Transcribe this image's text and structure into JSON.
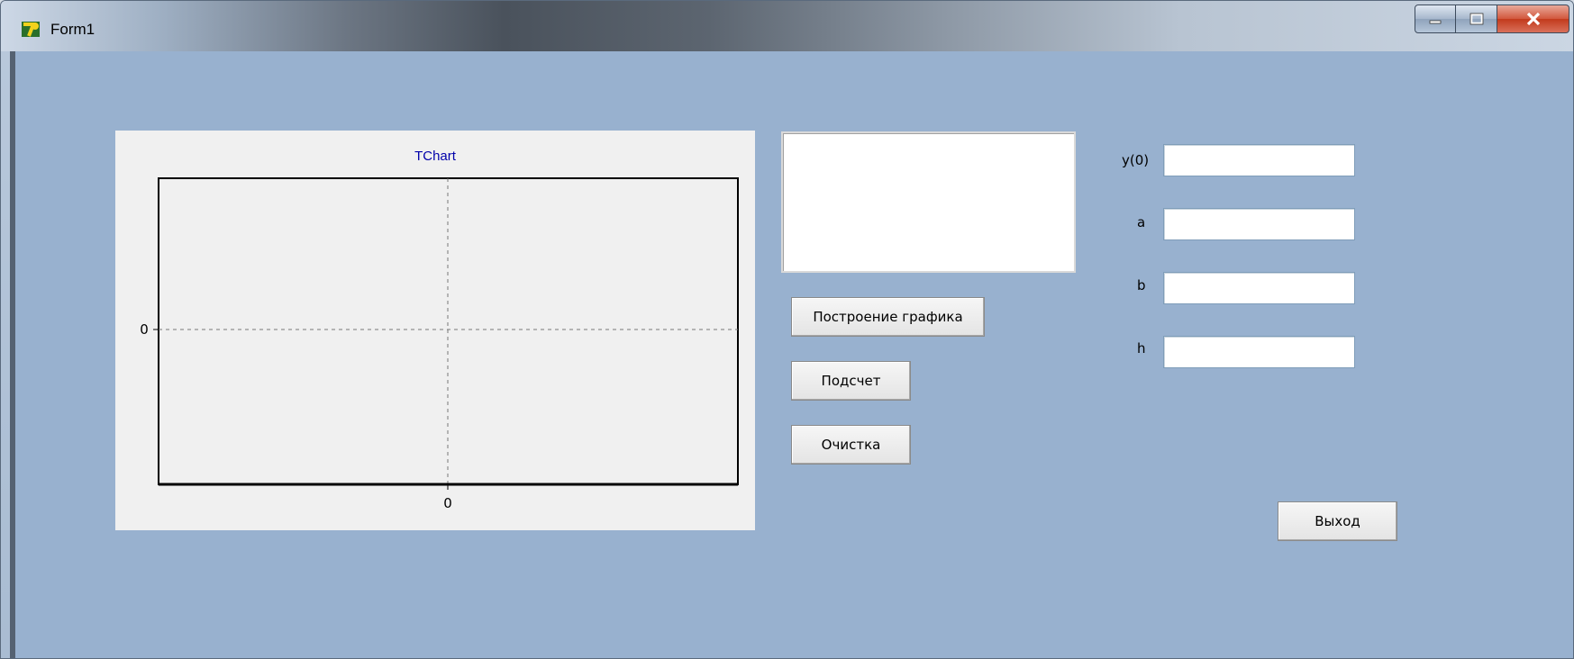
{
  "window": {
    "title": "Form1"
  },
  "chart": {
    "title": "TChart",
    "y_tick": "0",
    "x_tick": "0"
  },
  "chart_data": {
    "type": "line",
    "title": "TChart",
    "x": [],
    "y": [],
    "xticks": [
      "0"
    ],
    "yticks": [
      "0"
    ],
    "grid": true,
    "xlabel": "",
    "ylabel": ""
  },
  "buttons": {
    "plot": "Построение графика",
    "count": "Подсчет",
    "clear": "Очистка",
    "exit": "Выход"
  },
  "fields": {
    "y0": {
      "label": "y(0)",
      "value": ""
    },
    "a": {
      "label": "a",
      "value": ""
    },
    "b": {
      "label": "b",
      "value": ""
    },
    "h": {
      "label": "h",
      "value": ""
    }
  },
  "memo": {
    "value": ""
  },
  "colors": {
    "form_bg": "#98b1cf",
    "chart_title": "#0000aa"
  }
}
